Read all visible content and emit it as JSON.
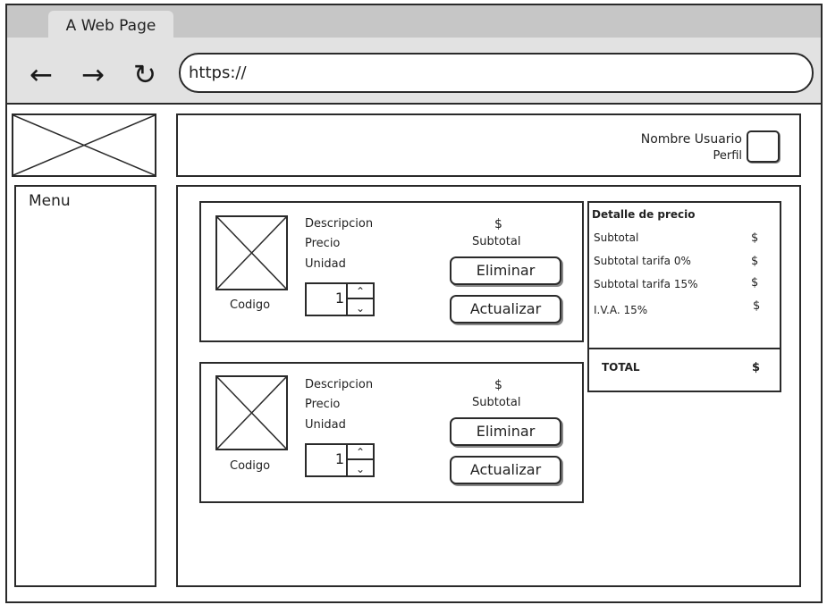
{
  "browser": {
    "tab_title": "A Web Page",
    "back_icon": "←",
    "forward_icon": "→",
    "reload_icon": "↻",
    "url": "https://"
  },
  "header": {
    "user_name": "Nombre Usuario",
    "profile_label": "Perfil"
  },
  "sidebar": {
    "menu_label": "Menu"
  },
  "cart": {
    "items": [
      {
        "code_label": "Codigo",
        "description_label": "Descripcion",
        "price_label": "Precio",
        "unit_label": "Unidad",
        "quantity": "1",
        "currency": "$",
        "subtotal_label": "Subtotal",
        "delete_label": "Eliminar",
        "update_label": "Actualizar"
      },
      {
        "code_label": "Codigo",
        "description_label": "Descripcion",
        "price_label": "Precio",
        "unit_label": "Unidad",
        "quantity": "1",
        "currency": "$",
        "subtotal_label": "Subtotal",
        "delete_label": "Eliminar",
        "update_label": "Actualizar"
      }
    ]
  },
  "price_detail": {
    "title": "Detalle de precio",
    "rows": [
      {
        "label": "Subtotal",
        "value": "$"
      },
      {
        "label": "Subtotal tarifa 0%",
        "value": "$"
      },
      {
        "label": "Subtotal tarifa 15%",
        "value": "$"
      },
      {
        "label": "I.V.A. 15%",
        "value": "$"
      }
    ],
    "total_label": "TOTAL",
    "total_value": "$"
  }
}
